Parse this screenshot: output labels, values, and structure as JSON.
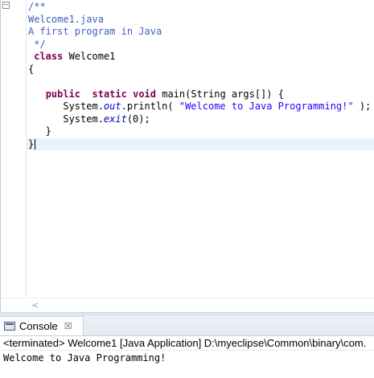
{
  "editor": {
    "lines": [
      {
        "parts": [
          {
            "t": "/**",
            "c": "c-doc"
          }
        ]
      },
      {
        "parts": [
          {
            "t": "Welcome1.java",
            "c": "c-doc"
          }
        ]
      },
      {
        "parts": [
          {
            "t": "A first program in Java",
            "c": "c-doc"
          }
        ]
      },
      {
        "parts": [
          {
            "t": " */",
            "c": "c-doc"
          }
        ]
      },
      {
        "parts": [
          {
            "t": " ",
            "c": ""
          },
          {
            "t": "class",
            "c": "kw"
          },
          {
            "t": " Welcome1",
            "c": ""
          }
        ]
      },
      {
        "parts": [
          {
            "t": "{",
            "c": ""
          }
        ]
      },
      {
        "parts": [
          {
            "t": "",
            "c": ""
          }
        ]
      },
      {
        "parts": [
          {
            "t": "   ",
            "c": ""
          },
          {
            "t": "public",
            "c": "kw"
          },
          {
            "t": "  ",
            "c": ""
          },
          {
            "t": "static",
            "c": "kw"
          },
          {
            "t": " ",
            "c": ""
          },
          {
            "t": "void",
            "c": "kw"
          },
          {
            "t": " main(String args[]) {",
            "c": ""
          }
        ]
      },
      {
        "parts": [
          {
            "t": "      System.",
            "c": ""
          },
          {
            "t": "out",
            "c": "it"
          },
          {
            "t": ".println( ",
            "c": ""
          },
          {
            "t": "\"Welcome to Java Programming!\"",
            "c": "str"
          },
          {
            "t": " );",
            "c": ""
          }
        ]
      },
      {
        "parts": [
          {
            "t": "      System.",
            "c": ""
          },
          {
            "t": "exit",
            "c": "it"
          },
          {
            "t": "(0);",
            "c": ""
          }
        ]
      },
      {
        "parts": [
          {
            "t": "   }",
            "c": ""
          }
        ]
      },
      {
        "parts": [
          {
            "t": "}",
            "c": ""
          }
        ],
        "current": true
      }
    ]
  },
  "scroll": {
    "left_arrow": "<"
  },
  "console": {
    "tab_label": "Console",
    "close_glyph": "☒",
    "status": "<terminated> Welcome1 [Java Application] D:\\myeclipse\\Common\\binary\\com.",
    "output": "Welcome to Java Programming!"
  },
  "icons": {
    "console": "console-icon",
    "close": "close-icon",
    "fold": "fold-collapse-icon"
  }
}
